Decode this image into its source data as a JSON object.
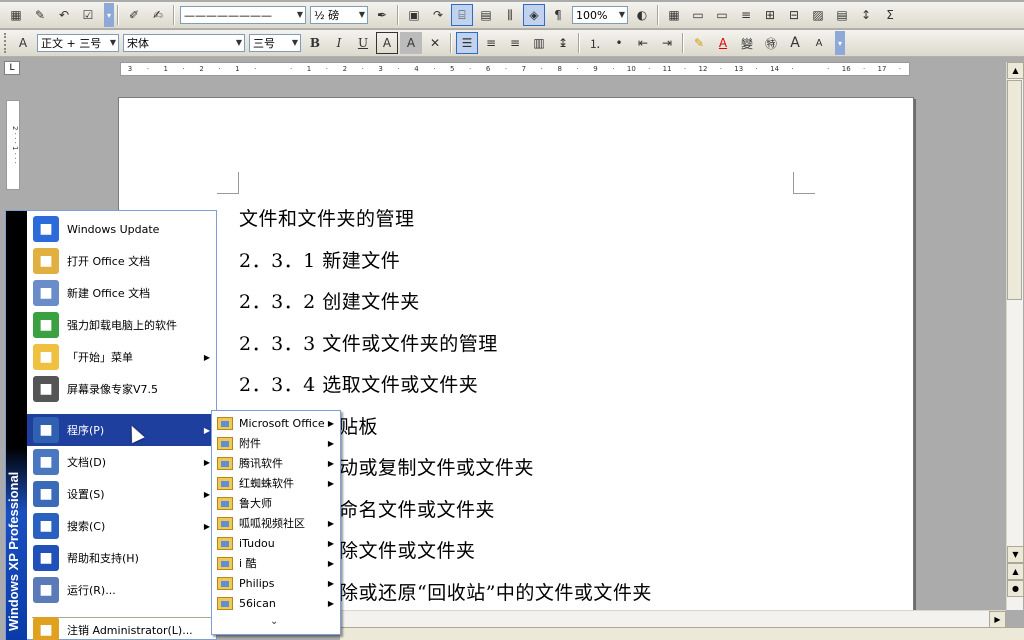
{
  "toolbar1": {
    "line_style": "————————",
    "line_weight": "½ 磅",
    "zoom": "100%"
  },
  "toolbar2": {
    "style": "正文 + 三号",
    "font": "宋体",
    "size": "三号",
    "bold_label": "B",
    "italic_label": "I",
    "underline_label": "U",
    "boxed_a": "A",
    "shaded_a": "A",
    "font_color_a": "A",
    "phonetic": "變",
    "enclose": "㊕",
    "grow_font": "A",
    "shrink_font": "A"
  },
  "ruler": {
    "corner": "L",
    "ticks": [
      "3",
      "·",
      "1",
      "·",
      "2",
      "·",
      "1",
      "·",
      "",
      "·",
      "1",
      "·",
      "2",
      "·",
      "3",
      "·",
      "4",
      "·",
      "5",
      "·",
      "6",
      "·",
      "7",
      "·",
      "8",
      "·",
      "9",
      "·",
      "10",
      "·",
      "11",
      "·",
      "12",
      "·",
      "13",
      "·",
      "14",
      "·",
      "",
      "·",
      "16",
      "·",
      "17",
      "·"
    ]
  },
  "vruler_text": "2 · · · 1 · · ·",
  "document": {
    "lines": [
      "文件和文件夹的管理",
      "2．3．1 新建文件",
      "2．3．2 创建文件夹",
      "2．3．3 文件或文件夹的管理",
      "2．3．4 选取文件或文件夹",
      "贴板",
      "动或复制文件或文件夹",
      "命名文件或文件夹",
      "除文件或文件夹",
      "除或还原“回收站”中的文件或文件夹"
    ]
  },
  "start_menu": {
    "band_text": "Windows XP Professional",
    "items": [
      {
        "label": "Windows Update",
        "icon": "windows-update-icon",
        "color": "#2d6cd8"
      },
      {
        "label": "打开 Office 文档",
        "icon": "open-office-document-icon",
        "color": "#e0b040"
      },
      {
        "label": "新建 Office 文档",
        "icon": "new-office-document-icon",
        "color": "#6a8cc8"
      },
      {
        "label": "强力卸载电脑上的软件",
        "icon": "uninstaller-icon",
        "color": "#3aa040"
      },
      {
        "label": "「开始」菜单",
        "icon": "start-menu-folder-icon",
        "color": "#f0c040",
        "submenu": true
      },
      {
        "label": "屏幕录像专家V7.5",
        "icon": "screen-recorder-icon",
        "color": "#555555"
      },
      {
        "label": "程序(P)",
        "icon": "programs-icon",
        "color": "#3060b0",
        "submenu": true,
        "selected": true
      },
      {
        "label": "文档(D)",
        "icon": "documents-icon",
        "color": "#4a78c0",
        "submenu": true
      },
      {
        "label": "设置(S)",
        "icon": "settings-icon",
        "color": "#3a6ab8",
        "submenu": true
      },
      {
        "label": "搜索(C)",
        "icon": "search-icon",
        "color": "#2a60c0",
        "submenu": true
      },
      {
        "label": "帮助和支持(H)",
        "icon": "help-icon",
        "color": "#2050b8"
      },
      {
        "label": "运行(R)...",
        "icon": "run-icon",
        "color": "#5a7ab8"
      },
      {
        "label": "注销 Administrator(L)...",
        "icon": "logoff-icon",
        "color": "#e0a020"
      }
    ]
  },
  "programs_submenu": {
    "items": [
      {
        "label": "Microsoft Office",
        "arrow": true
      },
      {
        "label": "附件",
        "arrow": true
      },
      {
        "label": "腾讯软件",
        "arrow": true
      },
      {
        "label": "红蜘蛛软件",
        "arrow": true
      },
      {
        "label": "鲁大师",
        "arrow": false
      },
      {
        "label": "呱呱视频社区",
        "arrow": true
      },
      {
        "label": "iTudou",
        "arrow": true
      },
      {
        "label": "i 酷",
        "arrow": true
      },
      {
        "label": "Philips",
        "arrow": true
      },
      {
        "label": "56ican",
        "arrow": true
      }
    ],
    "more": "⌄"
  }
}
